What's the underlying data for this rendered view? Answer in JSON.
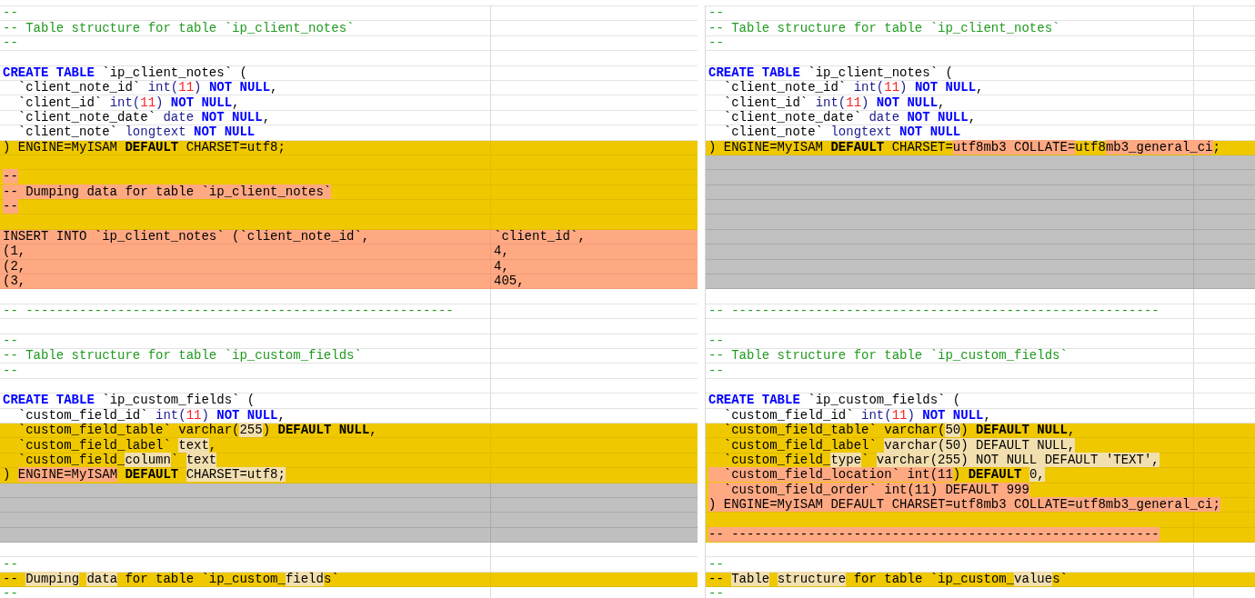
{
  "panes": [
    {
      "rows": [
        {
          "kind": "same",
          "cells": [
            [
              {
                "text": "--",
                "kind": "comment"
              }
            ]
          ]
        },
        {
          "kind": "same",
          "cells": [
            [
              {
                "text": "-- Table structure for table `ip_client_notes`",
                "kind": "comment"
              }
            ]
          ]
        },
        {
          "kind": "same",
          "cells": [
            [
              {
                "text": "--",
                "kind": "comment"
              }
            ]
          ]
        },
        {
          "kind": "same"
        },
        {
          "kind": "same",
          "cells": [
            [
              {
                "text": "CREATE TABLE",
                "kind": "keyword"
              },
              {
                "text": " `ip_client_notes` (",
                "kind": "plain"
              }
            ]
          ]
        },
        {
          "kind": "same",
          "cells": [
            [
              {
                "text": "  `client_note_id` ",
                "kind": "plain"
              },
              {
                "text": "int(",
                "kind": "type"
              },
              {
                "text": "11",
                "kind": "number"
              },
              {
                "text": ")",
                "kind": "type"
              },
              {
                "text": " ",
                "kind": "plain"
              },
              {
                "text": "NOT NULL",
                "kind": "keyword"
              },
              {
                "text": ",",
                "kind": "plain"
              }
            ]
          ]
        },
        {
          "kind": "same",
          "cells": [
            [
              {
                "text": "  `client_id` ",
                "kind": "plain"
              },
              {
                "text": "int(",
                "kind": "type"
              },
              {
                "text": "11",
                "kind": "number"
              },
              {
                "text": ")",
                "kind": "type"
              },
              {
                "text": " ",
                "kind": "plain"
              },
              {
                "text": "NOT NULL",
                "kind": "keyword"
              },
              {
                "text": ",",
                "kind": "plain"
              }
            ]
          ]
        },
        {
          "kind": "same",
          "cells": [
            [
              {
                "text": "  `client_note_date` ",
                "kind": "plain"
              },
              {
                "text": "date",
                "kind": "type"
              },
              {
                "text": " ",
                "kind": "plain"
              },
              {
                "text": "NOT NULL",
                "kind": "keyword"
              },
              {
                "text": ",",
                "kind": "plain"
              }
            ]
          ]
        },
        {
          "kind": "same",
          "cells": [
            [
              {
                "text": "  `client_note` ",
                "kind": "plain"
              },
              {
                "text": "longtext",
                "kind": "type"
              },
              {
                "text": " ",
                "kind": "plain"
              },
              {
                "text": "NOT NULL",
                "kind": "keyword"
              }
            ]
          ]
        },
        {
          "kind": "changed",
          "cells": [
            [
              {
                "text": ") ENGINE=MyISAM ",
                "kind": "plain"
              },
              {
                "text": "DEFAULT",
                "kind": "keyword"
              },
              {
                "text": " CHARSET=utf8;",
                "kind": "plain"
              }
            ]
          ]
        },
        {
          "kind": "changed"
        },
        {
          "kind": "changed",
          "cells": [
            [
              {
                "text": "--",
                "kind": "strong"
              }
            ]
          ]
        },
        {
          "kind": "changed",
          "cells": [
            [
              {
                "text": "-- Dumping data for table `ip_client_notes`",
                "kind": "strong"
              }
            ]
          ]
        },
        {
          "kind": "changed",
          "cells": [
            [
              {
                "text": "--",
                "kind": "strong"
              }
            ]
          ]
        },
        {
          "kind": "changed"
        },
        {
          "kind": "removed",
          "cells": [
            [
              {
                "text": "INSERT INTO `ip_client_notes` (`client_note_id`,",
                "kind": "plain"
              }
            ],
            [
              {
                "text": "`client_id`,",
                "kind": "plain"
              }
            ]
          ]
        },
        {
          "kind": "removed",
          "cells": [
            [
              {
                "text": "(1,",
                "kind": "plain"
              }
            ],
            [
              {
                "text": "4,",
                "kind": "plain"
              }
            ]
          ]
        },
        {
          "kind": "removed",
          "cells": [
            [
              {
                "text": "(2,",
                "kind": "plain"
              }
            ],
            [
              {
                "text": "4,",
                "kind": "plain"
              }
            ]
          ]
        },
        {
          "kind": "removed",
          "cells": [
            [
              {
                "text": "(3,",
                "kind": "plain"
              }
            ],
            [
              {
                "text": "405,",
                "kind": "plain"
              }
            ]
          ]
        },
        {
          "kind": "same"
        },
        {
          "kind": "same",
          "cells": [
            [
              {
                "text": "-- --------------------------------------------------------",
                "kind": "comment"
              }
            ]
          ]
        },
        {
          "kind": "same"
        },
        {
          "kind": "same",
          "cells": [
            [
              {
                "text": "--",
                "kind": "comment"
              }
            ]
          ]
        },
        {
          "kind": "same",
          "cells": [
            [
              {
                "text": "-- Table structure for table `ip_custom_fields`",
                "kind": "comment"
              }
            ]
          ]
        },
        {
          "kind": "same",
          "cells": [
            [
              {
                "text": "--",
                "kind": "comment"
              }
            ]
          ]
        },
        {
          "kind": "same"
        },
        {
          "kind": "same",
          "cells": [
            [
              {
                "text": "CREATE TABLE",
                "kind": "keyword"
              },
              {
                "text": " `ip_custom_fields` (",
                "kind": "plain"
              }
            ]
          ]
        },
        {
          "kind": "same",
          "cells": [
            [
              {
                "text": "  `custom_field_id` ",
                "kind": "plain"
              },
              {
                "text": "int(",
                "kind": "type"
              },
              {
                "text": "11",
                "kind": "number"
              },
              {
                "text": ")",
                "kind": "type"
              },
              {
                "text": " ",
                "kind": "plain"
              },
              {
                "text": "NOT NULL",
                "kind": "keyword"
              },
              {
                "text": ",",
                "kind": "plain"
              }
            ]
          ]
        },
        {
          "kind": "changed",
          "cells": [
            [
              {
                "text": "  `custom_field_table` varchar(",
                "kind": "plain"
              },
              {
                "text": "255",
                "kind": "soft"
              },
              {
                "text": ") ",
                "kind": "plain"
              },
              {
                "text": "DEFAULT NULL",
                "kind": "keyword"
              },
              {
                "text": ",",
                "kind": "plain"
              }
            ]
          ]
        },
        {
          "kind": "changed",
          "cells": [
            [
              {
                "text": "  `custom_field_label` ",
                "kind": "plain"
              },
              {
                "text": "text",
                "kind": "soft"
              },
              {
                "text": ",",
                "kind": "plain"
              }
            ]
          ]
        },
        {
          "kind": "changed",
          "cells": [
            [
              {
                "text": "  `custom_field_",
                "kind": "plain"
              },
              {
                "text": "column",
                "kind": "soft"
              },
              {
                "text": "` ",
                "kind": "plain"
              },
              {
                "text": "text",
                "kind": "soft"
              }
            ]
          ]
        },
        {
          "kind": "changed",
          "cells": [
            [
              {
                "text": ") ",
                "kind": "plain"
              },
              {
                "text": "ENGINE=MyISAM",
                "kind": "strong"
              },
              {
                "text": " ",
                "kind": "plain"
              },
              {
                "text": "DEFAULT",
                "kind": "keyword"
              },
              {
                "text": " ",
                "kind": "plain"
              },
              {
                "text": "CHARSET=utf8;",
                "kind": "soft"
              }
            ]
          ]
        },
        {
          "kind": "filler"
        },
        {
          "kind": "filler"
        },
        {
          "kind": "filler"
        },
        {
          "kind": "filler"
        },
        {
          "kind": "same"
        },
        {
          "kind": "same",
          "cells": [
            [
              {
                "text": "--",
                "kind": "comment"
              }
            ]
          ]
        },
        {
          "kind": "changed",
          "cells": [
            [
              {
                "text": "-- ",
                "kind": "plain"
              },
              {
                "text": "Dumping",
                "kind": "soft"
              },
              {
                "text": " ",
                "kind": "plain"
              },
              {
                "text": "data",
                "kind": "soft"
              },
              {
                "text": " for table `ip_custom_",
                "kind": "plain"
              },
              {
                "text": "field",
                "kind": "soft"
              },
              {
                "text": "s`",
                "kind": "plain"
              }
            ]
          ]
        },
        {
          "kind": "same",
          "cells": [
            [
              {
                "text": "--",
                "kind": "comment"
              }
            ]
          ]
        }
      ]
    },
    {
      "rows": [
        {
          "kind": "same",
          "cells": [
            [
              {
                "text": "--",
                "kind": "comment"
              }
            ]
          ]
        },
        {
          "kind": "same",
          "cells": [
            [
              {
                "text": "-- Table structure for table `ip_client_notes`",
                "kind": "comment"
              }
            ]
          ]
        },
        {
          "kind": "same",
          "cells": [
            [
              {
                "text": "--",
                "kind": "comment"
              }
            ]
          ]
        },
        {
          "kind": "same"
        },
        {
          "kind": "same",
          "cells": [
            [
              {
                "text": "CREATE TABLE",
                "kind": "keyword"
              },
              {
                "text": " `ip_client_notes` (",
                "kind": "plain"
              }
            ]
          ]
        },
        {
          "kind": "same",
          "cells": [
            [
              {
                "text": "  `client_note_id` ",
                "kind": "plain"
              },
              {
                "text": "int(",
                "kind": "type"
              },
              {
                "text": "11",
                "kind": "number"
              },
              {
                "text": ")",
                "kind": "type"
              },
              {
                "text": " ",
                "kind": "plain"
              },
              {
                "text": "NOT NULL",
                "kind": "keyword"
              },
              {
                "text": ",",
                "kind": "plain"
              }
            ]
          ]
        },
        {
          "kind": "same",
          "cells": [
            [
              {
                "text": "  `client_id` ",
                "kind": "plain"
              },
              {
                "text": "int(",
                "kind": "type"
              },
              {
                "text": "11",
                "kind": "number"
              },
              {
                "text": ")",
                "kind": "type"
              },
              {
                "text": " ",
                "kind": "plain"
              },
              {
                "text": "NOT NULL",
                "kind": "keyword"
              },
              {
                "text": ",",
                "kind": "plain"
              }
            ]
          ]
        },
        {
          "kind": "same",
          "cells": [
            [
              {
                "text": "  `client_note_date` ",
                "kind": "plain"
              },
              {
                "text": "date",
                "kind": "type"
              },
              {
                "text": " ",
                "kind": "plain"
              },
              {
                "text": "NOT NULL",
                "kind": "keyword"
              },
              {
                "text": ",",
                "kind": "plain"
              }
            ]
          ]
        },
        {
          "kind": "same",
          "cells": [
            [
              {
                "text": "  `client_note` ",
                "kind": "plain"
              },
              {
                "text": "longtext",
                "kind": "type"
              },
              {
                "text": " ",
                "kind": "plain"
              },
              {
                "text": "NOT NULL",
                "kind": "keyword"
              }
            ]
          ]
        },
        {
          "kind": "changed",
          "cells": [
            [
              {
                "text": ") ENGINE=MyISAM ",
                "kind": "plain"
              },
              {
                "text": "DEFAULT",
                "kind": "keyword"
              },
              {
                "text": " CHARSET=",
                "kind": "plain"
              },
              {
                "text": "utf8mb3 COLLATE=",
                "kind": "strong"
              },
              {
                "text": "utf8",
                "kind": "plain"
              },
              {
                "text": "mb3_general_ci",
                "kind": "strong"
              },
              {
                "text": ";",
                "kind": "plain"
              }
            ]
          ]
        },
        {
          "kind": "filler"
        },
        {
          "kind": "filler"
        },
        {
          "kind": "filler"
        },
        {
          "kind": "filler"
        },
        {
          "kind": "filler"
        },
        {
          "kind": "filler"
        },
        {
          "kind": "filler"
        },
        {
          "kind": "filler"
        },
        {
          "kind": "filler"
        },
        {
          "kind": "same"
        },
        {
          "kind": "same",
          "cells": [
            [
              {
                "text": "-- --------------------------------------------------------",
                "kind": "comment"
              }
            ]
          ]
        },
        {
          "kind": "same"
        },
        {
          "kind": "same",
          "cells": [
            [
              {
                "text": "--",
                "kind": "comment"
              }
            ]
          ]
        },
        {
          "kind": "same",
          "cells": [
            [
              {
                "text": "-- Table structure for table `ip_custom_fields`",
                "kind": "comment"
              }
            ]
          ]
        },
        {
          "kind": "same",
          "cells": [
            [
              {
                "text": "--",
                "kind": "comment"
              }
            ]
          ]
        },
        {
          "kind": "same"
        },
        {
          "kind": "same",
          "cells": [
            [
              {
                "text": "CREATE TABLE",
                "kind": "keyword"
              },
              {
                "text": " `ip_custom_fields` (",
                "kind": "plain"
              }
            ]
          ]
        },
        {
          "kind": "same",
          "cells": [
            [
              {
                "text": "  `custom_field_id` ",
                "kind": "plain"
              },
              {
                "text": "int(",
                "kind": "type"
              },
              {
                "text": "11",
                "kind": "number"
              },
              {
                "text": ")",
                "kind": "type"
              },
              {
                "text": " ",
                "kind": "plain"
              },
              {
                "text": "NOT NULL",
                "kind": "keyword"
              },
              {
                "text": ",",
                "kind": "plain"
              }
            ]
          ]
        },
        {
          "kind": "changed",
          "cells": [
            [
              {
                "text": "  `custom_field_table` varchar(",
                "kind": "plain"
              },
              {
                "text": "50",
                "kind": "soft"
              },
              {
                "text": ") ",
                "kind": "plain"
              },
              {
                "text": "DEFAULT NULL",
                "kind": "keyword"
              },
              {
                "text": ",",
                "kind": "plain"
              }
            ]
          ]
        },
        {
          "kind": "changed",
          "cells": [
            [
              {
                "text": "  `custom_field_label` ",
                "kind": "plain"
              },
              {
                "text": "varchar(50) DEFAULT NULL,",
                "kind": "soft"
              }
            ]
          ]
        },
        {
          "kind": "changed",
          "cells": [
            [
              {
                "text": "  `custom_field_",
                "kind": "plain"
              },
              {
                "text": "type",
                "kind": "soft"
              },
              {
                "text": "` ",
                "kind": "plain"
              },
              {
                "text": "varchar(255) NOT NULL DEFAULT 'TEXT',",
                "kind": "soft"
              }
            ]
          ]
        },
        {
          "kind": "changed",
          "cells": [
            [
              {
                "text": "  `custom_field_location` int(11",
                "kind": "strong"
              },
              {
                "text": ") ",
                "kind": "plain"
              },
              {
                "text": "DEFAULT",
                "kind": "keyword"
              },
              {
                "text": " ",
                "kind": "plain"
              },
              {
                "text": "0,",
                "kind": "soft"
              }
            ]
          ]
        },
        {
          "kind": "changed",
          "cells": [
            [
              {
                "text": "  `custom_field_order` int(11) DEFAULT 999",
                "kind": "strong"
              }
            ]
          ]
        },
        {
          "kind": "changed",
          "cells": [
            [
              {
                "text": ") ENGINE=MyISAM DEFAULT CHARSET=utf8mb3 COLLATE=utf8mb3_general_ci;",
                "kind": "strong"
              }
            ]
          ]
        },
        {
          "kind": "changed"
        },
        {
          "kind": "changed",
          "cells": [
            [
              {
                "text": "-- --------------------------------------------------------",
                "kind": "strong"
              }
            ]
          ]
        },
        {
          "kind": "same"
        },
        {
          "kind": "same",
          "cells": [
            [
              {
                "text": "--",
                "kind": "comment"
              }
            ]
          ]
        },
        {
          "kind": "changed",
          "cells": [
            [
              {
                "text": "-- ",
                "kind": "plain"
              },
              {
                "text": "Table",
                "kind": "soft"
              },
              {
                "text": " ",
                "kind": "plain"
              },
              {
                "text": "structure",
                "kind": "soft"
              },
              {
                "text": " for table `ip_custom_",
                "kind": "plain"
              },
              {
                "text": "value",
                "kind": "soft"
              },
              {
                "text": "s`",
                "kind": "plain"
              }
            ]
          ]
        },
        {
          "kind": "same",
          "cells": [
            [
              {
                "text": "--",
                "kind": "comment"
              }
            ]
          ]
        }
      ]
    }
  ]
}
